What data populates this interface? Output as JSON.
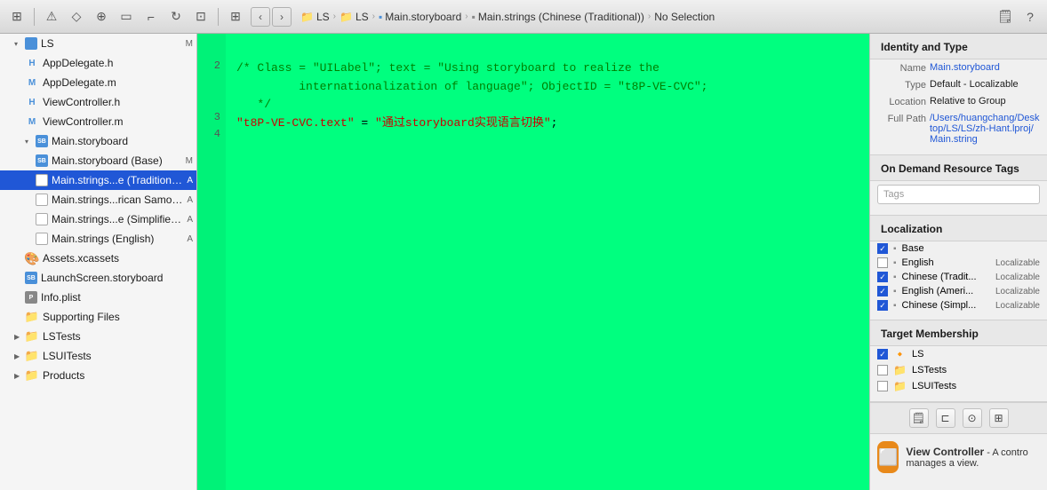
{
  "toolbar": {
    "breadcrumb": [
      {
        "label": "LS",
        "icon": "folder"
      },
      {
        "label": "LS",
        "icon": "folder-blue"
      },
      {
        "label": "Main.storyboard",
        "icon": "storyboard"
      },
      {
        "label": "Main.strings (Chinese (Traditional))",
        "icon": "strings"
      },
      {
        "label": "No Selection",
        "icon": null
      }
    ],
    "nav_back": "‹",
    "nav_forward": "›"
  },
  "sidebar": {
    "root_label": "LS",
    "badge": "M",
    "items": [
      {
        "id": "ls-root",
        "label": "LS",
        "indent": 0,
        "icon": "folder",
        "badge": "",
        "expanded": true
      },
      {
        "id": "app-delegate-h",
        "label": "AppDelegate.h",
        "indent": 1,
        "icon": "h",
        "badge": ""
      },
      {
        "id": "app-delegate-m",
        "label": "AppDelegate.m",
        "indent": 1,
        "icon": "m",
        "badge": ""
      },
      {
        "id": "viewcontroller-h",
        "label": "ViewController.h",
        "indent": 1,
        "icon": "h",
        "badge": ""
      },
      {
        "id": "viewcontroller-m",
        "label": "ViewController.m",
        "indent": 1,
        "icon": "m",
        "badge": ""
      },
      {
        "id": "main-storyboard",
        "label": "Main.storyboard",
        "indent": 1,
        "icon": "storyboard",
        "badge": "",
        "expanded": true
      },
      {
        "id": "main-storyboard-base",
        "label": "Main.storyboard (Base)",
        "indent": 2,
        "icon": "storyboard",
        "badge": "M"
      },
      {
        "id": "main-strings-traditional",
        "label": "Main.strings...e (Traditional))",
        "indent": 2,
        "icon": "strings",
        "badge": "A",
        "selected": true
      },
      {
        "id": "main-strings-american",
        "label": "Main.strings...rican Samoa))",
        "indent": 2,
        "icon": "strings",
        "badge": "A"
      },
      {
        "id": "main-strings-simplified",
        "label": "Main.strings...e (Simplified))",
        "indent": 2,
        "icon": "strings",
        "badge": "A"
      },
      {
        "id": "main-strings-english",
        "label": "Main.strings (English)",
        "indent": 2,
        "icon": "strings",
        "badge": "A"
      },
      {
        "id": "assets-xcassets",
        "label": "Assets.xcassets",
        "indent": 1,
        "icon": "xcassets",
        "badge": ""
      },
      {
        "id": "launchscreen-storyboard",
        "label": "LaunchScreen.storyboard",
        "indent": 1,
        "icon": "storyboard",
        "badge": ""
      },
      {
        "id": "info-plist",
        "label": "Info.plist",
        "indent": 1,
        "icon": "plist",
        "badge": ""
      },
      {
        "id": "supporting-files",
        "label": "Supporting Files",
        "indent": 1,
        "icon": "folder-yellow",
        "badge": ""
      },
      {
        "id": "lstests",
        "label": "LSTests",
        "indent": 0,
        "icon": "folder-blue",
        "badge": ""
      },
      {
        "id": "lsuitests",
        "label": "LSUITests",
        "indent": 0,
        "icon": "folder-blue",
        "badge": ""
      },
      {
        "id": "products",
        "label": "Products",
        "indent": 0,
        "icon": "folder-yellow",
        "badge": ""
      }
    ]
  },
  "editor": {
    "lines": [
      {
        "num": "2",
        "content": "/* Class = \"UILabel\"; text = \"Using storyboard to realize the",
        "type": "comment"
      },
      {
        "num": "",
        "content": "         internationalization of language\"; ObjectID = \"t8P-VE-CVC\";",
        "type": "comment"
      },
      {
        "num": "",
        "content": "   */",
        "type": "comment"
      },
      {
        "num": "3",
        "content": "\"t8P-VE-CVC.text\" = \"通过storyboard实现语言切换\";",
        "type": "code"
      },
      {
        "num": "4",
        "content": "",
        "type": "normal"
      }
    ]
  },
  "right_panel": {
    "identity_type": {
      "title": "Identity and Type",
      "name_label": "Name",
      "name_value": "Main.storyboard",
      "type_label": "Type",
      "type_value": "Default - Localizable",
      "location_label": "Location",
      "location_value": "Relative to Group",
      "full_path_label": "Full Path",
      "full_path_value": "/Users/huangchang/Desktop/LS/LS/zh-Hant.lproj/Main.string"
    },
    "on_demand": {
      "title": "On Demand Resource Tags",
      "tags_placeholder": "Tags"
    },
    "localization": {
      "title": "Localization",
      "items": [
        {
          "checked": true,
          "name": "Base",
          "localizable": ""
        },
        {
          "checked": false,
          "name": "English",
          "localizable": "Localizable"
        },
        {
          "checked": true,
          "name": "Chinese (Tradit...",
          "localizable": "Localizable"
        },
        {
          "checked": true,
          "name": "English (Ameri...",
          "localizable": "Localizable"
        },
        {
          "checked": true,
          "name": "Chinese (Simpl...",
          "localizable": "Localizable"
        }
      ]
    },
    "target_membership": {
      "title": "Target Membership",
      "items": [
        {
          "checked": true,
          "name": "LS",
          "icon": "app"
        },
        {
          "checked": false,
          "name": "LSTests",
          "icon": "folder"
        },
        {
          "checked": false,
          "name": "LSUITests",
          "icon": "folder"
        }
      ]
    },
    "bottom_buttons": [
      "doc",
      "adjust",
      "circle",
      "grid"
    ],
    "view_controller": {
      "title": "View Controller",
      "description": "- A contro manages a view."
    }
  }
}
